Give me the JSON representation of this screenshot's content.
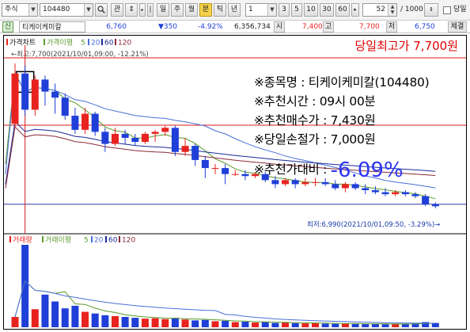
{
  "toolbar": {
    "market": "주식",
    "code": "104480",
    "search_icon": "search-icon",
    "btn_gwan": "관",
    "btn_updown": "⇕",
    "period_day": "일",
    "period_week": "주",
    "period_month": "월",
    "period_minute": "분",
    "period_tick": "틱",
    "period_year": "년",
    "unit_value": "1",
    "intervals": [
      "3",
      "5",
      "10",
      "30",
      "60"
    ],
    "count_value": "52",
    "total_label": "/ 1000",
    "sameday_label": "당일"
  },
  "quote": {
    "badge": "신",
    "name": "티케이케미칼",
    "price": "6,760",
    "change": "▼350",
    "change_pct": "-4.92%",
    "volume": "6,356,734",
    "open_label": "시",
    "open": "7,400",
    "high_label": "고",
    "high": "7,700",
    "low_label": "저",
    "low": "6,750",
    "exec_label": "체결"
  },
  "chart": {
    "price_legend": {
      "title": "가격차트",
      "ma_label": "가격이평",
      "periods": [
        "5",
        "20",
        "60",
        "120"
      ],
      "colors": [
        "#5a9a2a",
        "#4a6fd8",
        "#1a2a9a",
        "#8a2a3a"
      ]
    },
    "high_banner": "당일최고가 7,700원",
    "max_label": "←최고:7,700(2021/10/01,09:00, -12.21%)",
    "min_label": "최저:6,990(2021/10/01,09:50, -3.29%)→",
    "volume_legend": {
      "title": "거래량",
      "ma_label": "거래이평",
      "periods": [
        "5",
        "20",
        "60",
        "120"
      ]
    }
  },
  "info": {
    "name_line": "※종목명 : 티케이케미칼(104480)",
    "time_line": "※추천시간 : 09시 00분",
    "buy_line": "※추천매수가 : 7,430원",
    "stop_line": "※당일손절가 : 7,000원",
    "change_label": "※추천가대비 : ",
    "change_value": "-6.09%"
  },
  "colors": {
    "up": "#e8231f",
    "down": "#1f3fd8",
    "accent_red": "#e00000",
    "accent_blue": "#2b35f0"
  },
  "chart_data": {
    "type": "candlestick",
    "interval": "1분",
    "candles": [
      {
        "o": 7400,
        "h": 7700,
        "l": 7380,
        "c": 7650
      },
      {
        "o": 7650,
        "h": 7690,
        "l": 7440,
        "c": 7470
      },
      {
        "o": 7470,
        "h": 7640,
        "l": 7440,
        "c": 7620
      },
      {
        "o": 7620,
        "h": 7640,
        "l": 7490,
        "c": 7560
      },
      {
        "o": 7560,
        "h": 7600,
        "l": 7450,
        "c": 7530
      },
      {
        "o": 7530,
        "h": 7550,
        "l": 7420,
        "c": 7440
      },
      {
        "o": 7440,
        "h": 7480,
        "l": 7350,
        "c": 7370
      },
      {
        "o": 7370,
        "h": 7480,
        "l": 7350,
        "c": 7450
      },
      {
        "o": 7450,
        "h": 7460,
        "l": 7340,
        "c": 7360
      },
      {
        "o": 7360,
        "h": 7380,
        "l": 7260,
        "c": 7300
      },
      {
        "o": 7300,
        "h": 7380,
        "l": 7290,
        "c": 7350
      },
      {
        "o": 7350,
        "h": 7370,
        "l": 7300,
        "c": 7330
      },
      {
        "o": 7330,
        "h": 7350,
        "l": 7290,
        "c": 7310
      },
      {
        "o": 7310,
        "h": 7360,
        "l": 7300,
        "c": 7350
      },
      {
        "o": 7350,
        "h": 7370,
        "l": 7310,
        "c": 7360
      },
      {
        "o": 7360,
        "h": 7390,
        "l": 7340,
        "c": 7380
      },
      {
        "o": 7380,
        "h": 7390,
        "l": 7240,
        "c": 7260
      },
      {
        "o": 7260,
        "h": 7330,
        "l": 7240,
        "c": 7290
      },
      {
        "o": 7290,
        "h": 7300,
        "l": 7190,
        "c": 7220
      },
      {
        "o": 7220,
        "h": 7240,
        "l": 7130,
        "c": 7180
      },
      {
        "o": 7180,
        "h": 7200,
        "l": 7150,
        "c": 7180
      },
      {
        "o": 7180,
        "h": 7200,
        "l": 7100,
        "c": 7150
      },
      {
        "o": 7150,
        "h": 7170,
        "l": 7140,
        "c": 7150
      },
      {
        "o": 7150,
        "h": 7170,
        "l": 7120,
        "c": 7140
      },
      {
        "o": 7140,
        "h": 7160,
        "l": 7130,
        "c": 7150
      },
      {
        "o": 7150,
        "h": 7160,
        "l": 7110,
        "c": 7120
      },
      {
        "o": 7120,
        "h": 7140,
        "l": 7080,
        "c": 7100
      },
      {
        "o": 7100,
        "h": 7130,
        "l": 7090,
        "c": 7120
      },
      {
        "o": 7120,
        "h": 7130,
        "l": 7080,
        "c": 7100
      },
      {
        "o": 7100,
        "h": 7130,
        "l": 7090,
        "c": 7110
      },
      {
        "o": 7110,
        "h": 7130,
        "l": 7090,
        "c": 7110
      },
      {
        "o": 7110,
        "h": 7130,
        "l": 7090,
        "c": 7100
      },
      {
        "o": 7100,
        "h": 7120,
        "l": 7070,
        "c": 7080
      },
      {
        "o": 7080,
        "h": 7110,
        "l": 7060,
        "c": 7100
      },
      {
        "o": 7100,
        "h": 7110,
        "l": 7070,
        "c": 7080
      },
      {
        "o": 7080,
        "h": 7100,
        "l": 7050,
        "c": 7070
      },
      {
        "o": 7070,
        "h": 7090,
        "l": 7050,
        "c": 7060
      },
      {
        "o": 7060,
        "h": 7080,
        "l": 7040,
        "c": 7050
      },
      {
        "o": 7050,
        "h": 7070,
        "l": 7040,
        "c": 7060
      },
      {
        "o": 7060,
        "h": 7070,
        "l": 7040,
        "c": 7050
      },
      {
        "o": 7050,
        "h": 7060,
        "l": 7030,
        "c": 7040
      },
      {
        "o": 7040,
        "h": 7050,
        "l": 6990,
        "c": 7000
      },
      {
        "o": 7000,
        "h": 7010,
        "l": 6980,
        "c": 6990
      }
    ],
    "volume": [
      120,
      960,
      210,
      380,
      300,
      220,
      250,
      180,
      160,
      140,
      130,
      120,
      110,
      100,
      105,
      95,
      110,
      90,
      80,
      85,
      70,
      75,
      60,
      65,
      55,
      60,
      50,
      55,
      48,
      45,
      50,
      42,
      40,
      45,
      38,
      36,
      40,
      35,
      42,
      38,
      45,
      60,
      50
    ],
    "reference_lines": [
      {
        "name": "당일최고가",
        "value": 7700
      },
      {
        "name": "추천매수가",
        "value": 7430
      },
      {
        "name": "당일손절가",
        "value": 7000
      }
    ]
  }
}
